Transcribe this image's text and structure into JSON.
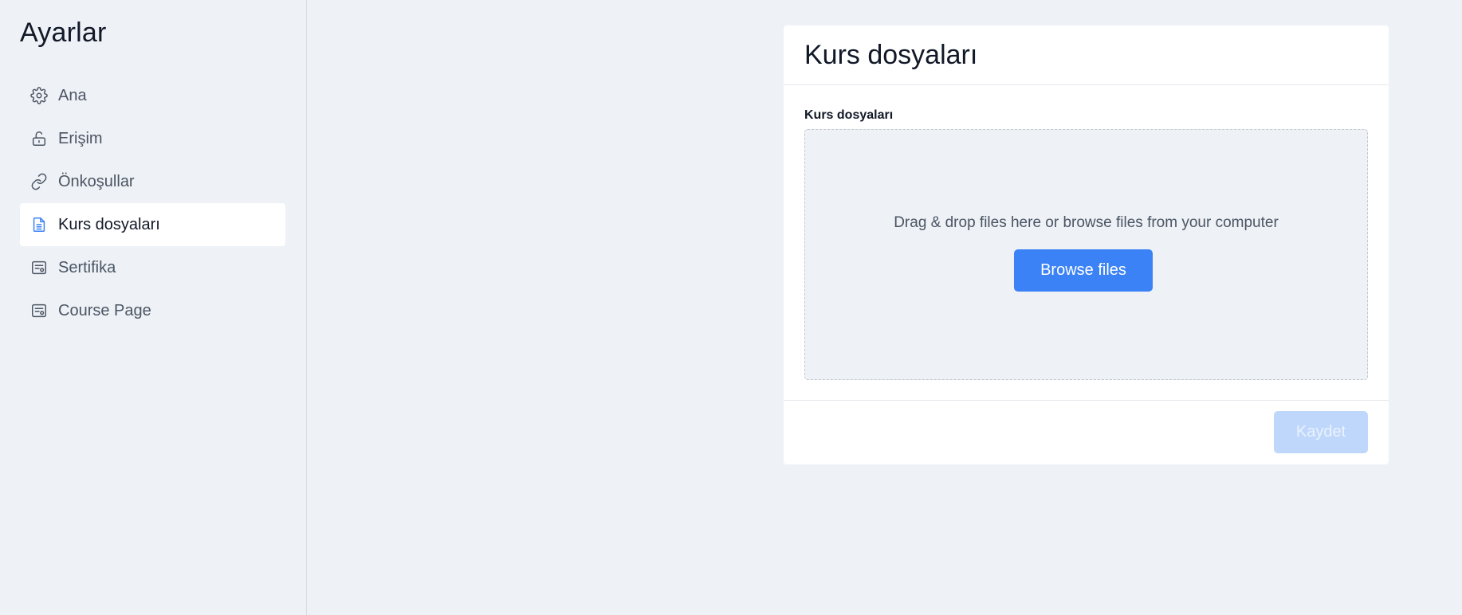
{
  "sidebar": {
    "title": "Ayarlar",
    "items": [
      {
        "label": "Ana",
        "icon": "gear-icon"
      },
      {
        "label": "Erişim",
        "icon": "unlock-icon"
      },
      {
        "label": "Önkoşullar",
        "icon": "link-icon"
      },
      {
        "label": "Kurs dosyaları",
        "icon": "document-icon",
        "active": true
      },
      {
        "label": "Sertifika",
        "icon": "certificate-icon"
      },
      {
        "label": "Course Page",
        "icon": "certificate-icon"
      }
    ]
  },
  "card": {
    "title": "Kurs dosyaları",
    "field_label": "Kurs dosyaları",
    "dropzone_text": "Drag & drop files here or browse files from your computer",
    "browse_label": "Browse files",
    "save_label": "Kaydet"
  },
  "colors": {
    "accent": "#3b82f6",
    "accent_disabled": "#bfd7fb",
    "background": "#eef1f6"
  }
}
